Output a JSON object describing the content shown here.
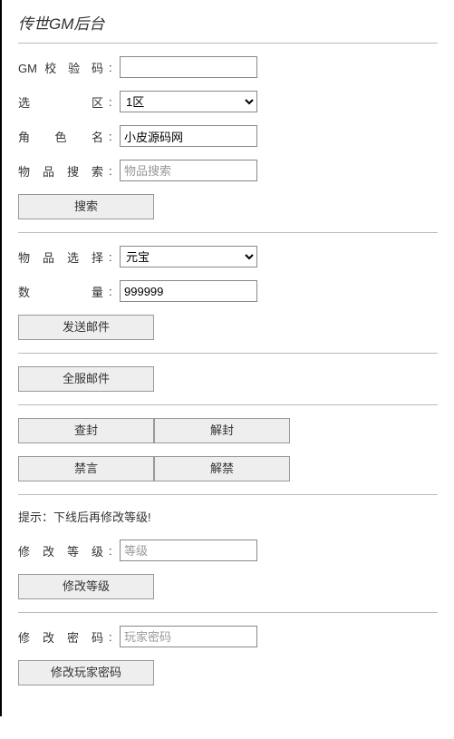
{
  "title": "传世GM后台",
  "fields": {
    "gm_code": {
      "label": "GM 校 验 码",
      "value": ""
    },
    "zone": {
      "label": "选 区",
      "selected": "1区",
      "options": [
        "1区"
      ]
    },
    "char_name": {
      "label": "角 色 名",
      "value": "小皮源码网"
    },
    "item_search": {
      "label": "物 品 搜 索",
      "placeholder": "物品搜索",
      "value": ""
    },
    "item_select": {
      "label": "物 品 选 择",
      "selected": "元宝",
      "options": [
        "元宝"
      ]
    },
    "quantity": {
      "label": "数 量",
      "value": "999999"
    },
    "level": {
      "label": "修 改 等 级",
      "placeholder": "等级",
      "value": ""
    },
    "password": {
      "label": "修 改 密 码",
      "placeholder": "玩家密码",
      "value": ""
    }
  },
  "buttons": {
    "search": "搜索",
    "send_mail": "发送邮件",
    "server_mail": "全服邮件",
    "ban_check": "查封",
    "unban": "解封",
    "mute": "禁言",
    "unmute": "解禁",
    "change_level": "修改等级",
    "change_password": "修改玩家密码"
  },
  "tip": "提示：下线后再修改等级!"
}
